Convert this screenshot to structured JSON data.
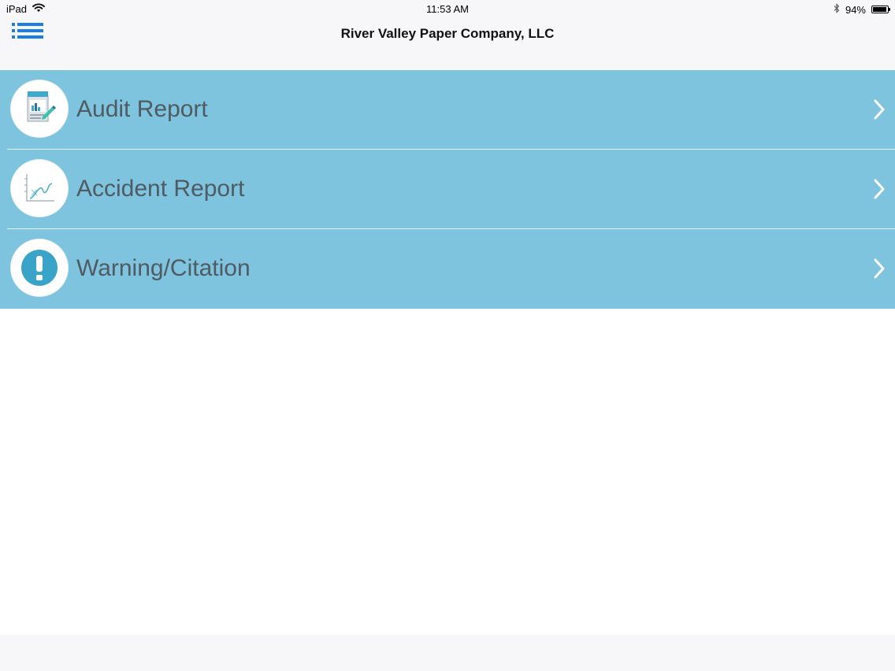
{
  "status_bar": {
    "device": "iPad",
    "time": "11:53 AM",
    "battery_text": "94%",
    "battery_level": 0.94,
    "icons": [
      "wifi-icon",
      "bluetooth-icon",
      "battery-icon"
    ]
  },
  "nav": {
    "title": "River Valley Paper Company, LLC",
    "menu_icon": "list-menu-icon",
    "menu_color": "#1a7fe0"
  },
  "menu": {
    "items": [
      {
        "label": "Audit Report",
        "icon": "audit-report-icon"
      },
      {
        "label": "Accident Report",
        "icon": "accident-chart-icon"
      },
      {
        "label": "Warning/Citation",
        "icon": "warning-exclamation-icon"
      }
    ],
    "row_color": "#7fc4de",
    "chevron_icon": "chevron-right-icon"
  }
}
